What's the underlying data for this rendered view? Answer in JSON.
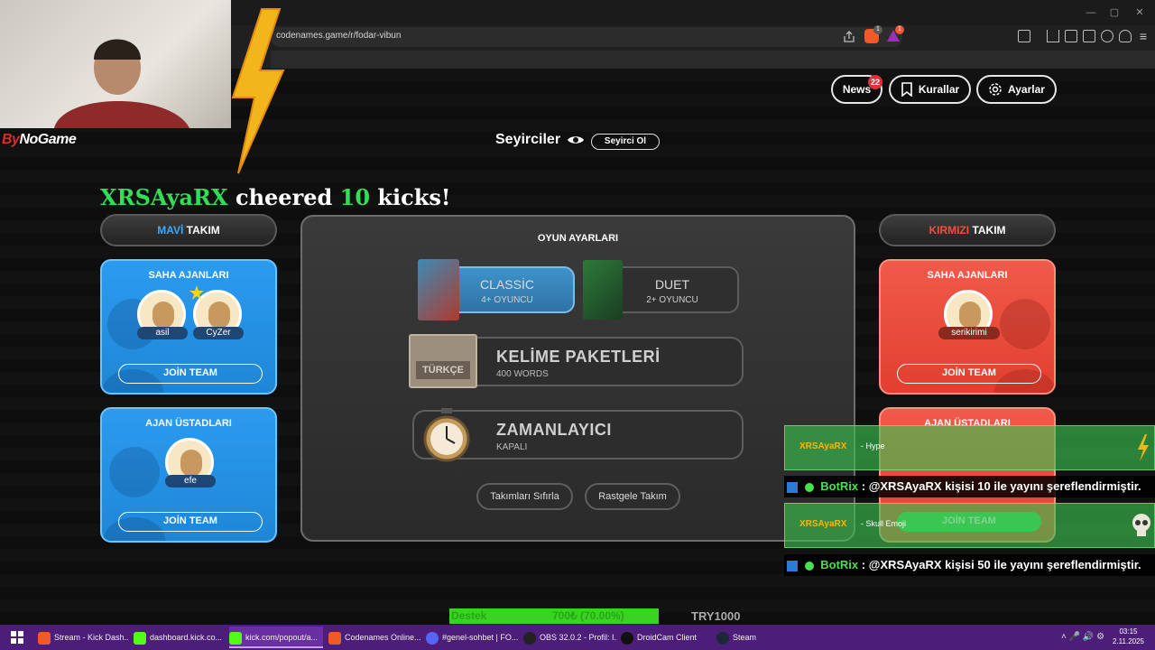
{
  "browser": {
    "url": "codenames.game/r/fodar-vibun",
    "shield_badge": "1",
    "reward_badge": "1"
  },
  "header": {
    "news_label": "News",
    "news_badge": "22",
    "rules_label": "Kurallar",
    "settings_label": "Ayarlar"
  },
  "spectators": {
    "label": "Seyirciler",
    "button": "Seyirci Ol"
  },
  "cheer": {
    "user": "XRSAyaRX",
    "text1": "cheered",
    "count": "10",
    "text2": "kicks!"
  },
  "blue_team": {
    "title_accent": "MAVİ",
    "title_rest": "TAKIM",
    "operatives_title": "SAHA AJANLARI",
    "operatives": [
      "asil",
      "CyZer"
    ],
    "spymasters_title": "AJAN ÜSTADLARI",
    "spymasters": [
      "efe"
    ],
    "join_label": "JOİN TEAM"
  },
  "red_team": {
    "title_accent": "KIRMIZI",
    "title_rest": "TAKIM",
    "operatives_title": "SAHA AJANLARI",
    "operatives": [
      "serikirimi"
    ],
    "spymasters_title": "AJAN ÜSTADLARI",
    "join_label": "JOİN TEAM"
  },
  "settings": {
    "title": "OYUN AYARLARI",
    "modes": [
      {
        "name": "CLASSİC",
        "players": "4+ OYUNCU",
        "selected": true
      },
      {
        "name": "DUET",
        "players": "2+ OYUNCU",
        "selected": false
      }
    ],
    "word_packs": {
      "title": "KELİME PAKETLERİ",
      "sub": "400 WORDS",
      "box_label": "TÜRKÇE"
    },
    "timer": {
      "title": "ZAMANLAYICI",
      "sub": "KAPALI"
    },
    "reset_teams": "Takımları Sıfırla",
    "random_teams": "Rastgele Takım"
  },
  "overlay": {
    "brand_prefix": "By",
    "brand_name": "NoGame",
    "alerts": [
      {
        "user": "XRSAyaRX",
        "message": "- Hype"
      },
      {
        "user": "XRSAyaRX",
        "message": "- Skull Emoji"
      }
    ],
    "chat": [
      {
        "user": "BotRix",
        "message": ": @XRSAyaRX kişisi 10 ile yayını şereflendirmiştir."
      },
      {
        "user": "BotRix",
        "message": ": @XRSAyaRX kişisi 50 ile yayını şereflendirmiştir."
      }
    ],
    "support": {
      "label": "Destek",
      "progress": "700₺ (70.00%)",
      "target": "TRY1000",
      "fraction": 0.7
    }
  },
  "taskbar": {
    "items": [
      "Stream - Kick Dash...",
      "dashboard.kick.co...",
      "kick.com/popout/a...",
      "Codenames Online...",
      "#genel-sohbet | FO...",
      "OBS 32.0.2 - Profil: I...",
      "DroidCam Client",
      "Steam"
    ],
    "time": "03:15",
    "date": "2.11.2025"
  },
  "colors": {
    "blue_card": "#2b9bf0",
    "red_card": "#f05a4a",
    "highlight_green": "#33dd55",
    "taskbar": "#4c1d79"
  }
}
